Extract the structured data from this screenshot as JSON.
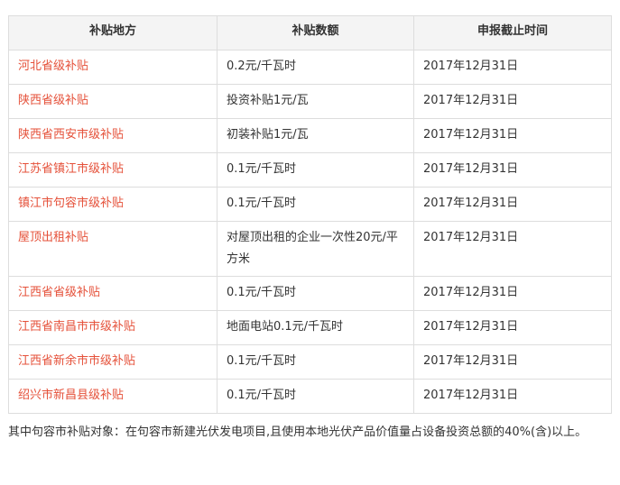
{
  "table": {
    "headers": [
      "补贴地方",
      "补贴数额",
      "申报截止时间"
    ],
    "rows": [
      {
        "region": "河北省级补贴",
        "amount": "0.2元/千瓦时",
        "deadline": "2017年12月31日"
      },
      {
        "region": "陕西省级补贴",
        "amount": "投资补贴1元/瓦",
        "deadline": "2017年12月31日"
      },
      {
        "region": "陕西省西安市级补贴",
        "amount": "初装补贴1元/瓦",
        "deadline": "2017年12月31日"
      },
      {
        "region": "江苏省镇江市级补贴",
        "amount": "0.1元/千瓦时",
        "deadline": "2017年12月31日"
      },
      {
        "region": "镇江市句容市级补贴",
        "amount": "0.1元/千瓦时",
        "deadline": "2017年12月31日"
      },
      {
        "region": "屋顶出租补贴",
        "amount": "对屋顶出租的企业一次性20元/平方米",
        "deadline": "2017年12月31日"
      },
      {
        "region": "江西省省级补贴",
        "amount": "0.1元/千瓦时",
        "deadline": "2017年12月31日"
      },
      {
        "region": "江西省南昌市市级补贴",
        "amount": "地面电站0.1元/千瓦时",
        "deadline": "2017年12月31日"
      },
      {
        "region": "江西省新余市市级补贴",
        "amount": "0.1元/千瓦时",
        "deadline": "2017年12月31日"
      },
      {
        "region": "绍兴市新昌县级补贴",
        "amount": "0.1元/千瓦时",
        "deadline": "2017年12月31日"
      }
    ]
  },
  "note": "其中句容市补贴对象：在句容市新建光伏发电项目,且使用本地光伏产品价值量占设备投资总额的40%(含)以上。",
  "colors": {
    "region_text": "#e5513a",
    "header_bg": "#f4f4f4",
    "border": "#dddddd",
    "body_text": "#333333"
  }
}
